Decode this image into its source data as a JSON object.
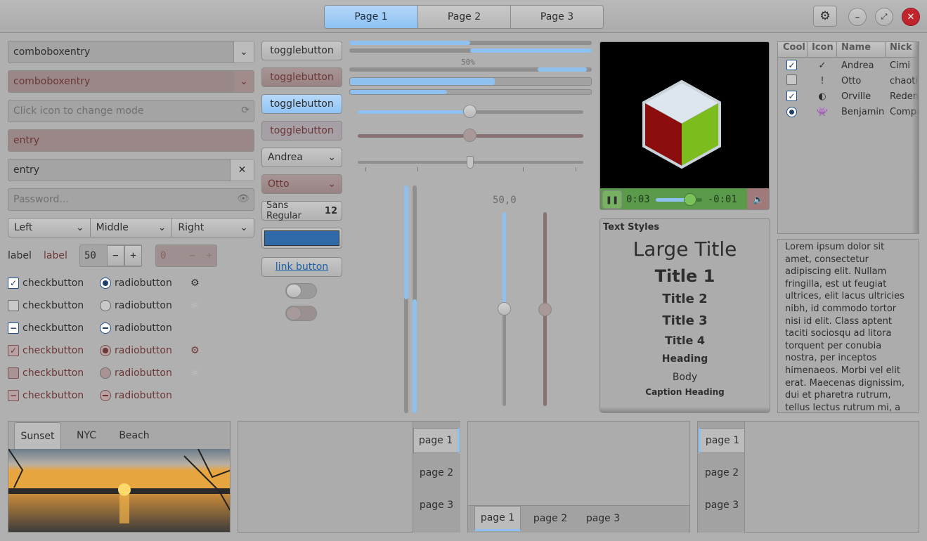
{
  "header": {
    "tabs": [
      "Page 1",
      "Page 2",
      "Page 3"
    ]
  },
  "left": {
    "combo1": "comboboxentry",
    "combo2": "comboboxentry",
    "mode_placeholder": "Click icon to change mode",
    "entry_red": "entry",
    "entry": "entry",
    "password_placeholder": "Password...",
    "align": [
      "Left",
      "Middle",
      "Right"
    ],
    "label1": "label",
    "label2": "label",
    "spin1": "50",
    "spin2": "0",
    "checks": [
      "checkbutton",
      "checkbutton",
      "checkbutton",
      "checkbutton",
      "checkbutton",
      "checkbutton"
    ],
    "radios": [
      "radiobutton",
      "radiobutton",
      "radiobutton",
      "radiobutton",
      "radiobutton",
      "radiobutton"
    ]
  },
  "mid": {
    "toggles": [
      "togglebutton",
      "togglebutton",
      "togglebutton",
      "togglebutton"
    ],
    "combo_andrea": "Andrea",
    "combo_otto": "Otto",
    "font_name": "Sans Regular",
    "font_size": "12",
    "color": "#2f6aa8",
    "link": "link button",
    "progress_label": "50%",
    "scale_value": "50,0"
  },
  "video": {
    "elapsed": "0:03",
    "remaining": "-0:01",
    "progress": 0.75
  },
  "tree": {
    "columns": [
      "Cool",
      "Icon",
      "Name",
      "Nick"
    ],
    "rows": [
      {
        "cool": "check",
        "icon": "✓",
        "name": "Andrea",
        "nick": "Cimi"
      },
      {
        "cool": "empty",
        "icon": "!",
        "name": "Otto",
        "nick": "chaotic"
      },
      {
        "cool": "check",
        "icon": "◐",
        "name": "Orville",
        "nick": "Reden..."
      },
      {
        "cool": "radio",
        "icon": "👾",
        "name": "Benjamin",
        "nick": "Compa"
      }
    ]
  },
  "styles": {
    "header": "Text Styles",
    "large": "Large Title",
    "t1": "Title 1",
    "t2": "Title 2",
    "t3": "Title 3",
    "t4": "Title 4",
    "heading": "Heading",
    "body": "Body",
    "caption": "Caption Heading"
  },
  "lorem": "Lorem ipsum dolor sit amet, consectetur adipiscing elit. Nullam fringilla, est ut feugiat ultrices, elit lacus ultricies nibh, id commodo tortor nisi id elit. Class aptent taciti sociosqu ad litora torquent per conubia nostra, per inceptos himenaeos. Morbi vel elit erat. Maecenas dignissim, dui et pharetra rutrum, tellus lectus rutrum mi, a convallis libero nisi",
  "notebook": {
    "photo_tabs": [
      "Sunset",
      "NYC",
      "Beach"
    ],
    "pages": [
      "page 1",
      "page 2",
      "page 3"
    ]
  }
}
